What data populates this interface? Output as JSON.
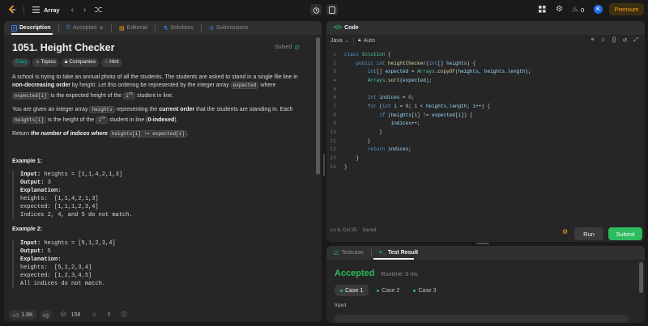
{
  "topbar": {
    "problem_list_label": "Array",
    "streak_count": "0",
    "avatar_letter": "K",
    "premium_label": "Premium"
  },
  "desc_tabs": [
    {
      "label": "Description",
      "active": true
    },
    {
      "label": "Accepted",
      "active": false
    },
    {
      "label": "Editorial",
      "active": false
    },
    {
      "label": "Solutions",
      "active": false
    },
    {
      "label": "Submissions",
      "active": false
    }
  ],
  "problem": {
    "title": "1051. Height Checker",
    "status": "Solved",
    "difficulty": "Easy",
    "tags": [
      "Topics",
      "Companies",
      "Hint"
    ],
    "p1_a": "A school is trying to take an annual photo of all the students. The students are asked to stand in a single file line in ",
    "p1_b": "non-decreasing order",
    "p1_c": " by height. Let this ordering be represented by the integer array ",
    "p1_code1": "expected",
    "p1_d": " where ",
    "p1_code2": "expected[i]",
    "p1_e": " is the expected height of the ",
    "p1_i": "i",
    "p1_sup": "th",
    "p1_f": " student in line.",
    "p2_a": "You are given an integer array ",
    "p2_code1": "heights",
    "p2_b": " representing the ",
    "p2_c": "current order",
    "p2_d": " that the students are standing in. Each ",
    "p2_code2": "heights[i]",
    "p2_e": " is the height of the ",
    "p2_i": "i",
    "p2_sup": "th",
    "p2_f": " student in line (",
    "p2_g": "0-indexed",
    "p2_h": ").",
    "p3_a": "Return ",
    "p3_b": "the number of indices where",
    "p3_code": "heights[i] != expected[i]",
    "p3_c": ".",
    "ex1_title": "Example 1:",
    "ex1": {
      "input_label": "Input:",
      "input": "heights = [1,1,4,2,1,3]",
      "output_label": "Output:",
      "output": "3",
      "explanation_label": "Explanation:",
      "lines": [
        "heights:  [1,1,4,2,1,3]",
        "expected: [1,1,1,2,3,4]",
        "Indices 2, 4, and 5 do not match."
      ]
    },
    "ex2_title": "Example 2:",
    "ex2": {
      "input_label": "Input:",
      "input": "heights = [5,1,2,3,4]",
      "output_label": "Output:",
      "output": "5",
      "explanation_label": "Explanation:",
      "lines": [
        "heights:  [5,1,2,3,4]",
        "expected: [1,2,3,4,5]",
        "All indices do not match."
      ]
    }
  },
  "desc_footer": {
    "likes": "1.6K",
    "comments": "158"
  },
  "code_panel": {
    "title": "Code",
    "language": "Java",
    "auto_label": "Auto",
    "lines": [
      [
        [
          "kw",
          "class "
        ],
        [
          "ty",
          "Solution"
        ],
        [
          "pl",
          " {"
        ]
      ],
      [
        [
          "pl",
          "    "
        ],
        [
          "kw",
          "public int "
        ],
        [
          "fn",
          "heightChecker"
        ],
        [
          "pl",
          "("
        ],
        [
          "kw",
          "int"
        ],
        [
          "pl",
          "[] "
        ],
        [
          "vr",
          "heights"
        ],
        [
          "pl",
          ") {"
        ]
      ],
      [
        [
          "pl",
          "        "
        ],
        [
          "kw",
          "int"
        ],
        [
          "pl",
          "[] "
        ],
        [
          "vr",
          "expected"
        ],
        [
          "pl",
          " = "
        ],
        [
          "ty",
          "Arrays"
        ],
        [
          "pl",
          "."
        ],
        [
          "fn",
          "copyOf"
        ],
        [
          "pl",
          "("
        ],
        [
          "vr",
          "heights"
        ],
        [
          "pl",
          ", "
        ],
        [
          "vr",
          "heights"
        ],
        [
          "pl",
          "."
        ],
        [
          "vr",
          "length"
        ],
        [
          "pl",
          ");"
        ]
      ],
      [
        [
          "pl",
          "        "
        ],
        [
          "ty",
          "Arrays"
        ],
        [
          "pl",
          "."
        ],
        [
          "fn",
          "sort"
        ],
        [
          "pl",
          "("
        ],
        [
          "vr",
          "expected"
        ],
        [
          "pl",
          ");"
        ]
      ],
      [
        [
          "pl",
          ""
        ]
      ],
      [
        [
          "pl",
          "        "
        ],
        [
          "kw",
          "int "
        ],
        [
          "vr",
          "indices"
        ],
        [
          "pl",
          " = "
        ],
        [
          "nm",
          "0"
        ],
        [
          "pl",
          ";"
        ]
      ],
      [
        [
          "pl",
          "        "
        ],
        [
          "kw",
          "for "
        ],
        [
          "pl",
          "("
        ],
        [
          "kw",
          "int "
        ],
        [
          "vr",
          "i"
        ],
        [
          "pl",
          " = "
        ],
        [
          "nm",
          "0"
        ],
        [
          "pl",
          "; "
        ],
        [
          "vr",
          "i"
        ],
        [
          "pl",
          " < "
        ],
        [
          "vr",
          "heights"
        ],
        [
          "pl",
          "."
        ],
        [
          "vr",
          "length"
        ],
        [
          "pl",
          "; "
        ],
        [
          "vr",
          "i"
        ],
        [
          "pl",
          "++) {"
        ]
      ],
      [
        [
          "pl",
          "            "
        ],
        [
          "kw",
          "if "
        ],
        [
          "pl",
          "("
        ],
        [
          "vr",
          "heights"
        ],
        [
          "pl",
          "["
        ],
        [
          "vr",
          "i"
        ],
        [
          "pl",
          "] != "
        ],
        [
          "vr",
          "expected"
        ],
        [
          "pl",
          "["
        ],
        [
          "vr",
          "i"
        ],
        [
          "pl",
          "]) {"
        ]
      ],
      [
        [
          "pl",
          "                "
        ],
        [
          "vr",
          "indices"
        ],
        [
          "pl",
          "++;"
        ]
      ],
      [
        [
          "pl",
          "            }"
        ]
      ],
      [
        [
          "pl",
          "        }"
        ]
      ],
      [
        [
          "pl",
          "        "
        ],
        [
          "kw",
          "return "
        ],
        [
          "vr",
          "indices"
        ],
        [
          "pl",
          ";"
        ]
      ],
      [
        [
          "pl",
          "    }"
        ]
      ],
      [
        [
          "pl",
          "}"
        ]
      ]
    ],
    "cursor_pos": "Ln 6, Col 25",
    "saved_label": "Saved",
    "run_label": "Run",
    "submit_label": "Submit"
  },
  "result_panel": {
    "tab_testcase": "Testcase",
    "tab_result": "Test Result",
    "status": "Accepted",
    "runtime": "Runtime: 0 ms",
    "cases": [
      "Case 1",
      "Case 2",
      "Case 3"
    ],
    "input_label": "Input"
  },
  "colors": {
    "accent_green": "#2cbb5d",
    "premium": "#ffa116",
    "easy": "#00b8a3",
    "submit_bg": "#2cbb5d"
  }
}
